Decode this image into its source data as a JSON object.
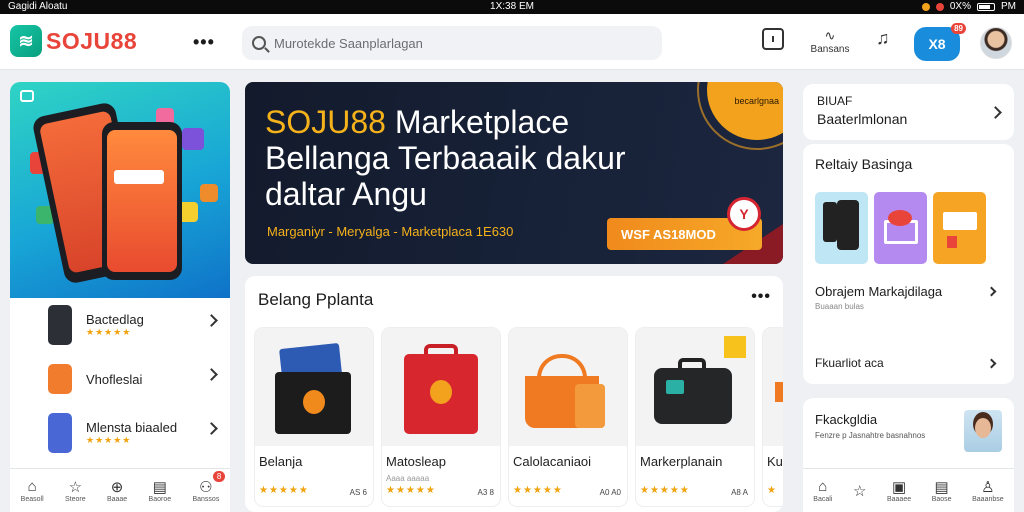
{
  "status": {
    "left": "Gagidi Aloatu",
    "time": "1X:38 EM",
    "right_pct": "0X%",
    "right_extra": "PM"
  },
  "header": {
    "logo_text": "SOJU88",
    "search_placeholder": "Murotekde Saanplarlagan",
    "notif_label": "Bansans",
    "cart_text": "X8",
    "cart_badge": "89"
  },
  "left_panel": {
    "items": [
      {
        "name": "Bactedlag",
        "stars": "★★★★★",
        "color": "#2c2f36"
      },
      {
        "name": "Vhofleslai",
        "stars": "",
        "color": "#f27c2e"
      },
      {
        "name": "Mlensta biaaled",
        "stars": "★★★★★",
        "color": "#4a67d6"
      }
    ]
  },
  "hero": {
    "title_accent": "SOJU88",
    "title_rest": " Marketplace Bellanga Terbaaaik dakur daltar Angu",
    "subtitle": "Marganiyr - Meryalga - Marketplaca 1E630",
    "cta": "WSF AS18MOD",
    "pin": "Y",
    "sun_text": "becarlgnaa"
  },
  "products": {
    "title": "Belang Pplanta",
    "items": [
      {
        "name": "Belanja",
        "stars": "★★★★★",
        "price": "AS 6",
        "sub": ""
      },
      {
        "name": "Matosleap",
        "stars": "★★★★★",
        "price": "A3 8",
        "sub": "Aaaa aaaaa"
      },
      {
        "name": "Calolacaniaoi",
        "stars": "★★★★★",
        "price": "A0 A0",
        "sub": ""
      },
      {
        "name": "Markerplanain",
        "stars": "★★★★★",
        "price": "A8 A",
        "sub": ""
      },
      {
        "name": "Ku",
        "stars": "★",
        "price": "",
        "sub": ""
      }
    ]
  },
  "right_panel": {
    "card1": {
      "line1": "BIUAF",
      "line2": "Baaterlmlonan"
    },
    "card2": {
      "title": "Reltaiy Basinga",
      "option1": {
        "title": "Obrajem Markajdilaga",
        "sub": "Buaaan bulas"
      },
      "option2": {
        "title": "Fkuarliot aca"
      }
    },
    "card3": {
      "title": "Fkackgldia",
      "desc": "Fenzre p Jasnahtre basnahnos"
    }
  },
  "bottom_nav_left": [
    {
      "icon": "⌂",
      "label": "Beasoll"
    },
    {
      "icon": "☆",
      "label": "Steore"
    },
    {
      "icon": "⊕",
      "label": "Baaae"
    },
    {
      "icon": "▤",
      "label": "Baoroe"
    },
    {
      "icon": "⚇",
      "label": "Banssos",
      "badge": "8"
    }
  ],
  "bottom_nav_right": [
    {
      "icon": "⌂",
      "label": "Bacali"
    },
    {
      "icon": "☆",
      "label": ""
    },
    {
      "icon": "▣",
      "label": "Baaaee"
    },
    {
      "icon": "▤",
      "label": "Baose"
    },
    {
      "icon": "♙",
      "label": "Baaanbse"
    }
  ]
}
